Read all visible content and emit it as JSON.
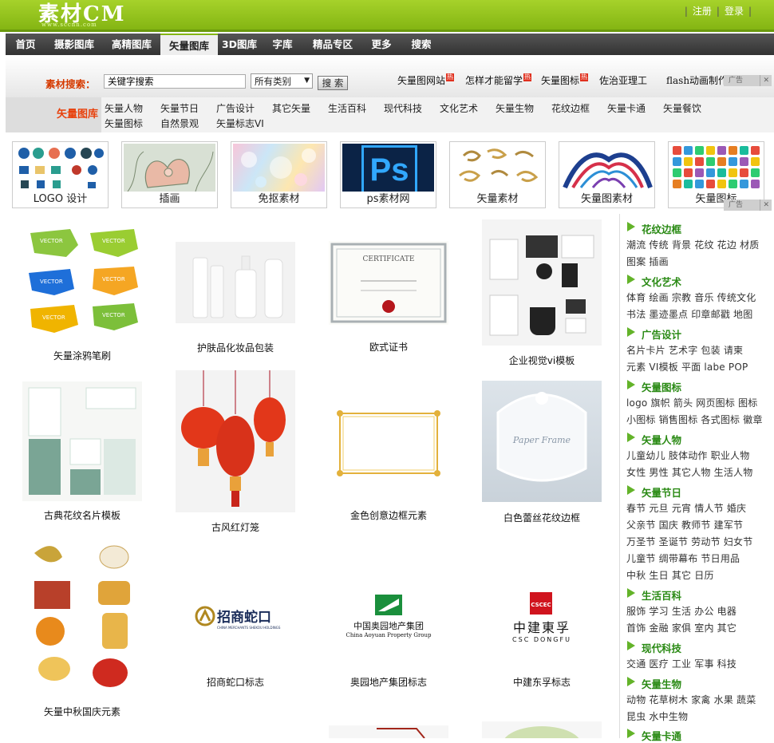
{
  "header": {
    "logo": "素材CM",
    "logo_sub": "www.sccnn.com",
    "register": "注册",
    "login": "登录"
  },
  "nav": [
    "首页",
    "摄影图库",
    "高精图库",
    "矢量图库",
    "3D图库",
    "字库",
    "精品专区",
    "更多",
    "搜索"
  ],
  "search": {
    "label": "素材搜索：",
    "value": "关键字搜索",
    "select": "所有类别",
    "button": "搜 索"
  },
  "hot": [
    {
      "text": "矢量图网站",
      "badge": "热"
    },
    {
      "text": "怎样才能留学",
      "badge": "热"
    },
    {
      "text": "矢量图标",
      "badge": "热"
    },
    {
      "text": "佐治亚理工",
      "badge": ""
    },
    {
      "text": "flash动画制作",
      "badge": ""
    }
  ],
  "ad": {
    "label": "广告",
    "close": "✕"
  },
  "categories": {
    "label": "矢量图库",
    "row1": [
      "矢量人物",
      "矢量节日",
      "广告设计",
      "其它矢量",
      "生活百科",
      "现代科技",
      "文化艺术",
      "矢量生物",
      "花纹边框",
      "矢量卡通",
      "矢量餐饮"
    ],
    "row2": [
      "矢量图标",
      "自然景观",
      "矢量标志VI"
    ]
  },
  "thumbs": [
    "LOGO 设计",
    "插画",
    "免抠素材",
    "ps素材网",
    "矢量素材",
    "矢量图素材",
    "矢量图标"
  ],
  "ps_text": "Ps",
  "cards": [
    "矢量涂鸦笔刷",
    "护肤品化妆品包装",
    "欧式证书",
    "企业视觉vi模板",
    "古典花纹名片模板",
    "古风红灯笼",
    "金色创意边框元素",
    "白色蕾丝花纹边框",
    "矢量中秋国庆元素",
    "招商蛇口标志",
    "奥园地产集团标志",
    "中建东孚标志"
  ],
  "card_text": {
    "vector": "VECTOR",
    "cert": "CERTIFICATE",
    "paper": "Paper Frame",
    "cm_logo": "招商蛇口",
    "cm_sub": "CHINA MERCHANTS SHEKOU HOLDINGS",
    "ay_cn": "中国奥园地产集团",
    "ay_en": "China Aoyuan Property Group",
    "csc_cn": "中建東孚",
    "csc_en": "CSC DONGFU",
    "csc_badge": "CSCEC"
  },
  "side": [
    {
      "title": "花纹边框",
      "lines": [
        "潮流 传统 背景 花纹 花边 材质",
        "图案 插画"
      ]
    },
    {
      "title": "文化艺术",
      "lines": [
        "体育 绘画 宗教 音乐 传统文化",
        "书法 墨迹墨点 印章邮戳 地图"
      ]
    },
    {
      "title": "广告设计",
      "lines": [
        "名片卡片 艺术字 包装 请柬",
        "元素 VI模板 平面 labe POP"
      ]
    },
    {
      "title": "矢量图标",
      "lines": [
        "logo 旗帜 箭头 网页图标 图标",
        "小图标 销售图标 各式图标 徽章"
      ]
    },
    {
      "title": "矢量人物",
      "lines": [
        "儿童幼儿 肢体动作 职业人物",
        "女性 男性 其它人物 生活人物"
      ]
    },
    {
      "title": "矢量节日",
      "lines": [
        "春节 元旦 元宵 情人节 婚庆",
        "父亲节 国庆 教师节 建军节",
        "万圣节 圣诞节 劳动节 妇女节",
        "儿童节 绸带幕布 节日用品",
        "中秋 生日 其它 日历"
      ]
    },
    {
      "title": "生活百科",
      "lines": [
        "服饰 学习 生活 办公 电器",
        "首饰 金融 家俱 室内 其它"
      ]
    },
    {
      "title": "现代科技",
      "lines": [
        "交通 医疗 工业 军事 科技"
      ]
    },
    {
      "title": "矢量生物",
      "lines": [
        "动物 花草树木 家禽 水果 蔬菜",
        "昆虫 水中生物"
      ]
    },
    {
      "title": "矢量卡通",
      "lines": []
    }
  ],
  "colors": {
    "green": "#84b513",
    "red": "#e8400b",
    "nav": "#3a3a3a"
  }
}
